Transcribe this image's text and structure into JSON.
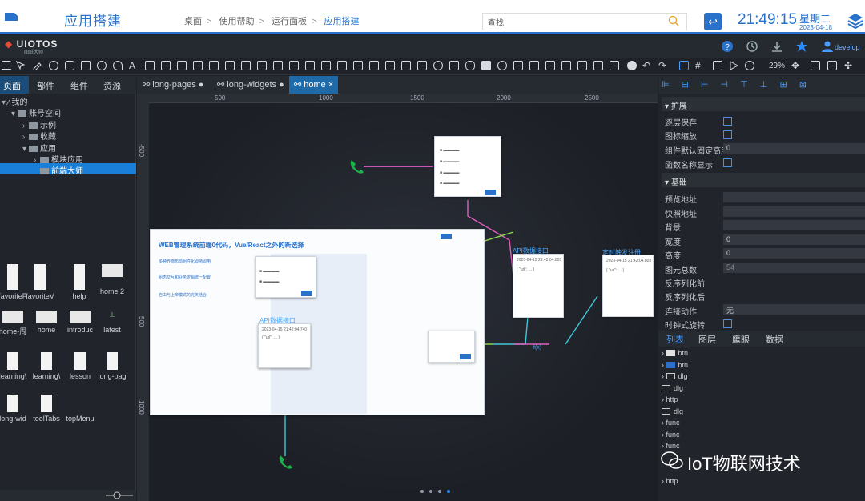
{
  "header": {
    "app_title": "应用搭建",
    "breadcrumb": [
      "桌面",
      "使用帮助",
      "运行面板",
      "应用搭建"
    ],
    "search_placeholder": "查找",
    "time": "21:49:15",
    "weekday": "星期二",
    "date": "2023-04-18"
  },
  "brand": {
    "name": "UIOTOS",
    "sub": "图纸大师",
    "user": "develop"
  },
  "toolbar": {
    "zoom": "29%"
  },
  "left_panel": {
    "tabs": [
      "页面",
      "部件",
      "组件",
      "资源"
    ],
    "tree": [
      {
        "label": "我的",
        "level": 0
      },
      {
        "label": "账号空间",
        "level": 1
      },
      {
        "label": "示例",
        "level": 2
      },
      {
        "label": "收藏",
        "level": 2
      },
      {
        "label": "应用",
        "level": 2
      },
      {
        "label": "模块应用",
        "level": 3
      },
      {
        "label": "前端大师",
        "level": 3,
        "selected": true
      }
    ],
    "thumbnails": [
      "favoriteP",
      "favoriteV",
      "help",
      "home 2",
      "home-周",
      "home",
      "introduc",
      "latest",
      "learning\\",
      "learning\\",
      "lesson",
      "long-pag",
      "long-wid",
      "toolTabs",
      "topMenu"
    ]
  },
  "doc_tabs": [
    "long-pages",
    "long-widgets",
    "home"
  ],
  "ruler": {
    "h": [
      "500",
      "1000",
      "1500",
      "2000",
      "2500"
    ],
    "v": [
      "-500",
      "500",
      "1000"
    ]
  },
  "canvas": {
    "banner_title": "WEB管理系统前端0代码，Vue/React之外的新选择",
    "banner_lines": [
      "多种界面布局组件化即拖即用",
      "组态交互和业务逻辑统一配置",
      "自由与上帝模式的完美结合"
    ],
    "node_api1": "API数据接口",
    "node_api2": "API数据接口",
    "node_timer": "定时触发注册",
    "node_ts": [
      "2023-04-15 21:42:04.740",
      "2023-04-15 21:42:04.803",
      "2023-04-15 21:42:04.803"
    ],
    "func_label": "f(x)"
  },
  "right_panel": {
    "sections": [
      "扩展",
      "基础"
    ],
    "ext_props": [
      {
        "label": "逐层保存",
        "type": "checkbox"
      },
      {
        "label": "图标缩放",
        "type": "checkbox"
      },
      {
        "label": "组件默认固定高度",
        "value": "0"
      },
      {
        "label": "函数名称显示",
        "type": "checkbox"
      }
    ],
    "base_props": [
      {
        "label": "预览地址",
        "value": ""
      },
      {
        "label": "快照地址",
        "value": ""
      },
      {
        "label": "背景",
        "value": ""
      },
      {
        "label": "宽度",
        "value": "0"
      },
      {
        "label": "高度",
        "value": "0"
      },
      {
        "label": "图元总数",
        "value": "54"
      },
      {
        "label": "反序列化前",
        "value": ""
      },
      {
        "label": "反序列化后",
        "value": ""
      },
      {
        "label": "连接动作",
        "value": "无"
      },
      {
        "label": "时钟式旋转",
        "type": "checkbox"
      }
    ],
    "tabs": [
      "列表",
      "图层",
      "鹰眼",
      "数据"
    ],
    "list": [
      "btn",
      "btn",
      "dlg",
      "dlg",
      "http",
      "dlg",
      "func",
      "func",
      "func",
      "http"
    ]
  },
  "watermark": "IoT物联网技术",
  "colors": {
    "accent": "#2a72c9",
    "selected": "#1a7fd9",
    "link_pink": "#e060c0",
    "link_green": "#8ed64a",
    "link_cyan": "#3ec8d8"
  }
}
